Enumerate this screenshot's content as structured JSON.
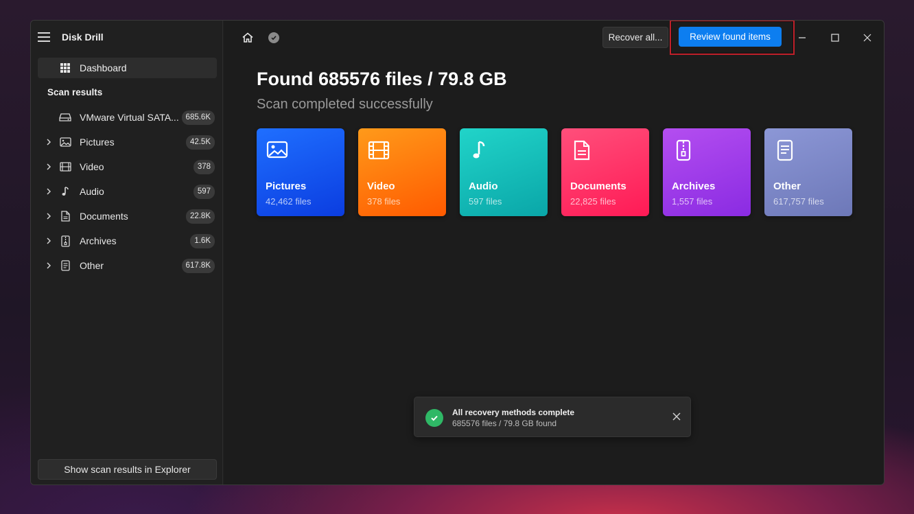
{
  "app": {
    "title": "Disk Drill"
  },
  "sidebar": {
    "dashboard_label": "Dashboard",
    "section_label": "Scan results",
    "items": [
      {
        "label": "VMware Virtual SATA...",
        "count": "685.6K",
        "icon": "hard-drive-icon",
        "expandable": false
      },
      {
        "label": "Pictures",
        "count": "42.5K",
        "icon": "image-icon",
        "expandable": true
      },
      {
        "label": "Video",
        "count": "378",
        "icon": "film-icon",
        "expandable": true
      },
      {
        "label": "Audio",
        "count": "597",
        "icon": "music-note-icon",
        "expandable": true
      },
      {
        "label": "Documents",
        "count": "22.8K",
        "icon": "document-icon",
        "expandable": true
      },
      {
        "label": "Archives",
        "count": "1.6K",
        "icon": "archive-icon",
        "expandable": true
      },
      {
        "label": "Other",
        "count": "617.8K",
        "icon": "file-icon",
        "expandable": true
      }
    ],
    "explorer_button": "Show scan results in Explorer"
  },
  "toolbar": {
    "recover_all_label": "Recover all...",
    "review_label": "Review found items"
  },
  "main": {
    "headline": "Found 685576 files / 79.8 GB",
    "subline": "Scan completed successfully",
    "cards": [
      {
        "title": "Pictures",
        "sub": "42,462 files",
        "icon": "image-icon",
        "colors": [
          "#1f6fff",
          "#0b3de0"
        ]
      },
      {
        "title": "Video",
        "sub": "378 files",
        "icon": "film-icon",
        "colors": [
          "#ff9a1a",
          "#ff5a00"
        ]
      },
      {
        "title": "Audio",
        "sub": "597 files",
        "icon": "music-note-icon",
        "colors": [
          "#21d4c9",
          "#0aa6a8"
        ]
      },
      {
        "title": "Documents",
        "sub": "22,825 files",
        "icon": "document-icon",
        "colors": [
          "#ff4f7b",
          "#ff1a55"
        ]
      },
      {
        "title": "Archives",
        "sub": "1,557 files",
        "icon": "archive-icon",
        "colors": [
          "#b44ef0",
          "#8a2be2"
        ]
      },
      {
        "title": "Other",
        "sub": "617,757 files",
        "icon": "file-icon",
        "colors": [
          "#8c97d6",
          "#6d78b8"
        ]
      }
    ]
  },
  "toast": {
    "title": "All recovery methods complete",
    "sub": "685576 files / 79.8 GB found"
  },
  "colors": {
    "accent": "#0d7ef0",
    "highlight": "#c0202a",
    "success": "#2fb866"
  }
}
